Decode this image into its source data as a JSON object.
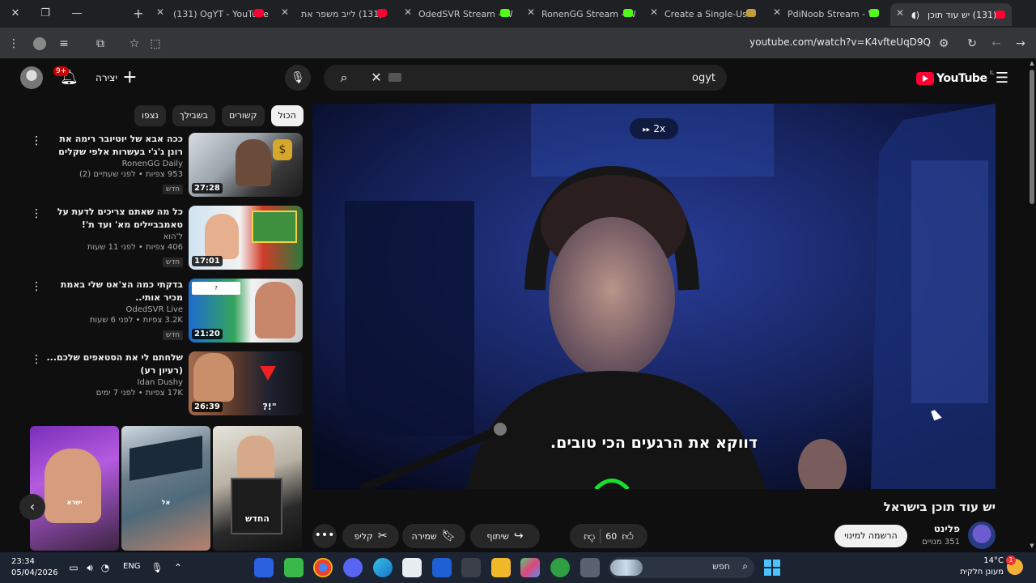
{
  "browser": {
    "tabs": [
      {
        "title": "(131) OgYT - YouTube",
        "favicon": "youtube-icon"
      },
      {
        "title": "(131) לייב משפר את",
        "favicon": "youtube-icon"
      },
      {
        "title": "OdedSVR Stream - W",
        "favicon": "kick-icon"
      },
      {
        "title": "RonenGG Stream - W",
        "favicon": "kick-icon"
      },
      {
        "title": "Create a Single-Use",
        "favicon": "doc-icon"
      },
      {
        "title": "PdiNoob Stream - W",
        "favicon": "kick-icon"
      },
      {
        "title": "(131) יש עוד תוכן",
        "favicon": "youtube-icon"
      }
    ],
    "url": "youtube.com/watch?v=K4vfteUqD9Q"
  },
  "header": {
    "notification_count": "9+",
    "create_label": "יצירה",
    "search_value": "ogyt",
    "logo_text": "YouTube",
    "country_code": "IL"
  },
  "chips": [
    "הכול",
    "קשורים",
    "בשבילך",
    "נצפו"
  ],
  "related": [
    {
      "title": "ככה אבא של יוטיובר רימה את רונן ג'ג'י בעשרות אלפי שקלים",
      "channel": "RonenGG Daily",
      "stats": "953 צפיות • לפני שעתיים (2)",
      "badge": "חדש",
      "duration": "27:28"
    },
    {
      "title": "כל מה שאתם צריכים לדעת על טאמבביילים מא' ועד ת'!",
      "channel": "ל'הוא",
      "stats": "406 צפיות • לפני 11 שעות",
      "badge": "חדש",
      "duration": "17:01"
    },
    {
      "title": "בדקתי כמה הצ'אט שלי באמת מכיר אותי..",
      "channel": "OdedSVR Live",
      "stats": "3.2K צפיות • לפני 6 שעות",
      "badge": "חדש",
      "duration": "21:20"
    },
    {
      "title": "שלחתם לי את הסטאפים שלכם... (רעיון רע)",
      "channel": "Idan Dushy",
      "stats": "17K צפיות • לפני 7 ימים",
      "badge": "",
      "duration": "26:39"
    }
  ],
  "shorts": [
    {
      "overlay": "ישרא"
    },
    {
      "overlay": "אל"
    },
    {
      "overlay": "החדש"
    }
  ],
  "player": {
    "speed": "2x",
    "subtitle": "דווקא את הרגעים הכי טובים."
  },
  "video": {
    "title": "יש עוד תוכן בישראל",
    "channel": "פלינט",
    "subscribers": "351 מנויים",
    "subscribe_label": "הרשמה למינוי",
    "likes": "60",
    "share_label": "שיתוף",
    "save_label": "שמירה",
    "clip_label": "קליפ"
  },
  "taskbar": {
    "time": "23:34",
    "date": "05/04/2026",
    "language": "ENG",
    "search_label": "חפש",
    "temperature": "14°C",
    "weather_text": "מעונן חלקית",
    "notification_count": "1"
  },
  "colors": {
    "background": "#0f0f0f",
    "chip": "#272727",
    "youtube_red": "#ff0033",
    "kick_green": "#53fc18"
  }
}
